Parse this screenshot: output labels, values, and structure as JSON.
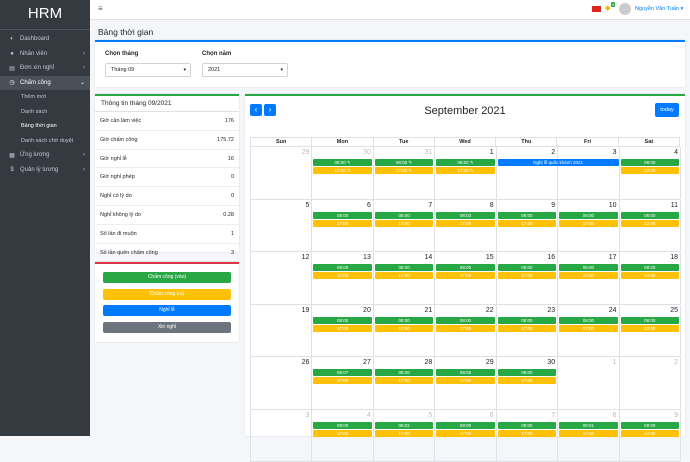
{
  "app": {
    "brand": "HRM"
  },
  "sidebar": {
    "items": [
      {
        "icon": "dashboard-icon",
        "glyph": "◐",
        "label": "Dashboard",
        "arrow": ""
      },
      {
        "icon": "users-icon",
        "glyph": "●",
        "label": "Nhân viên",
        "arrow": "‹"
      },
      {
        "icon": "file-icon",
        "glyph": "▤",
        "label": "Đơn xin nghỉ",
        "arrow": "‹"
      },
      {
        "icon": "clock-icon",
        "glyph": "◷",
        "label": "Chấm công",
        "arrow": "⌄",
        "active": true,
        "subs": [
          {
            "label": "Thêm mới"
          },
          {
            "label": "Danh sách"
          },
          {
            "label": "Bảng thời gian",
            "active": true
          },
          {
            "label": "Danh sách chờ duyệt"
          }
        ]
      },
      {
        "icon": "list-icon",
        "glyph": "▦",
        "label": "Ứng lương",
        "arrow": "‹"
      },
      {
        "icon": "dollar-icon",
        "glyph": "$",
        "label": "Quản lý lương",
        "arrow": "‹"
      }
    ]
  },
  "topbar": {
    "menu_glyph": "≡",
    "bell_glyph": "🔔",
    "badge": "5",
    "user": "Nguyễn Văn Tuấn ▾"
  },
  "page": {
    "title": "Bảng thời gian"
  },
  "filters": {
    "month_label": "Chọn tháng",
    "month_value": "Tháng 09",
    "year_label": "Chọn năm",
    "year_value": "2021"
  },
  "info": {
    "title": "Thông tin tháng 09/2021",
    "rows": [
      {
        "label": "Giờ cần làm việc",
        "value": "176"
      },
      {
        "label": "Giờ chấm công",
        "value": "175.72"
      },
      {
        "label": "Giờ nghỉ lễ",
        "value": "16"
      },
      {
        "label": "Giờ nghỉ phép",
        "value": "0"
      },
      {
        "label": "Nghỉ có lý do",
        "value": "0"
      },
      {
        "label": "Nghỉ không lý do",
        "value": "0.28"
      },
      {
        "label": "Số lần đi muộn",
        "value": "1"
      },
      {
        "label": "Số lần quên chấm công",
        "value": "3"
      }
    ]
  },
  "legend": [
    {
      "label": "Chấm công (vào)",
      "color": "#28a745"
    },
    {
      "label": "Chấm công (ra)",
      "color": "#ffc107"
    },
    {
      "label": "Nghỉ lễ",
      "color": "#007bff"
    },
    {
      "label": "Xin nghỉ",
      "color": "#6c757d"
    }
  ],
  "calendar": {
    "title": "September 2021",
    "prev": "‹",
    "next": "›",
    "today": "today",
    "days": [
      "Sun",
      "Mon",
      "Tue",
      "Wed",
      "Thu",
      "Fri",
      "Sat"
    ],
    "weeks": [
      [
        {
          "d": "29",
          "o": true
        },
        {
          "d": "30",
          "o": true,
          "in": "08:00 ✎",
          "out": "17:00 ✎"
        },
        {
          "d": "31",
          "o": true,
          "in": "08:00 ✎",
          "out": "17:00 ✎"
        },
        {
          "d": "1",
          "in": "08:00 ✎",
          "out": "17:00 ✎"
        },
        {
          "d": "2"
        },
        {
          "d": "3"
        },
        {
          "d": "4",
          "in": "08:00",
          "out": "12:00"
        }
      ],
      [
        {
          "d": "5"
        },
        {
          "d": "6",
          "in": "08:00",
          "out": "17:00"
        },
        {
          "d": "7",
          "in": "08:00",
          "out": "17:00"
        },
        {
          "d": "8",
          "in": "08:03",
          "out": "17:00"
        },
        {
          "d": "9",
          "in": "08:00",
          "out": "17:00"
        },
        {
          "d": "10",
          "in": "08:00",
          "out": "17:00"
        },
        {
          "d": "11",
          "in": "08:00",
          "out": "12:00"
        }
      ],
      [
        {
          "d": "12"
        },
        {
          "d": "13",
          "in": "08:00",
          "out": "17:00"
        },
        {
          "d": "14",
          "in": "08:00",
          "out": "17:00"
        },
        {
          "d": "15",
          "in": "08:00",
          "out": "17:00"
        },
        {
          "d": "16",
          "in": "08:00",
          "out": "17:00"
        },
        {
          "d": "17",
          "in": "08:00",
          "out": "17:00"
        },
        {
          "d": "18",
          "in": "08:00",
          "out": "12:00"
        }
      ],
      [
        {
          "d": "19"
        },
        {
          "d": "20",
          "in": "08:00",
          "out": "17:00"
        },
        {
          "d": "21",
          "in": "08:00",
          "out": "17:00"
        },
        {
          "d": "22",
          "in": "08:00",
          "out": "17:00"
        },
        {
          "d": "23",
          "in": "08:00",
          "out": "17:00"
        },
        {
          "d": "24",
          "in": "08:00",
          "out": "17:00"
        },
        {
          "d": "25",
          "in": "08:00",
          "out": "12:00"
        }
      ],
      [
        {
          "d": "26"
        },
        {
          "d": "27",
          "in": "08:07",
          "out": "17:00"
        },
        {
          "d": "28",
          "in": "08:00",
          "out": "17:00"
        },
        {
          "d": "29",
          "in": "08:05",
          "out": "17:00"
        },
        {
          "d": "30",
          "in": "08:00",
          "out": "17:00"
        },
        {
          "d": "1",
          "o": true
        },
        {
          "d": "2",
          "o": true
        }
      ],
      [
        {
          "d": "3",
          "o": true
        },
        {
          "d": "4",
          "o": true,
          "in": "08:00",
          "out": "17:00"
        },
        {
          "d": "5",
          "o": true,
          "in": "08:02",
          "out": "17:00"
        },
        {
          "d": "6",
          "o": true,
          "in": "08:00",
          "out": "17:00"
        },
        {
          "d": "7",
          "o": true,
          "in": "08:00",
          "out": "17:00"
        },
        {
          "d": "8",
          "o": true,
          "in": "08:01",
          "out": "17:00"
        },
        {
          "d": "9",
          "o": true,
          "in": "08:00",
          "out": "12:00"
        }
      ]
    ],
    "holiday": {
      "label": "Nghỉ lễ quốc khánh 2021"
    }
  }
}
